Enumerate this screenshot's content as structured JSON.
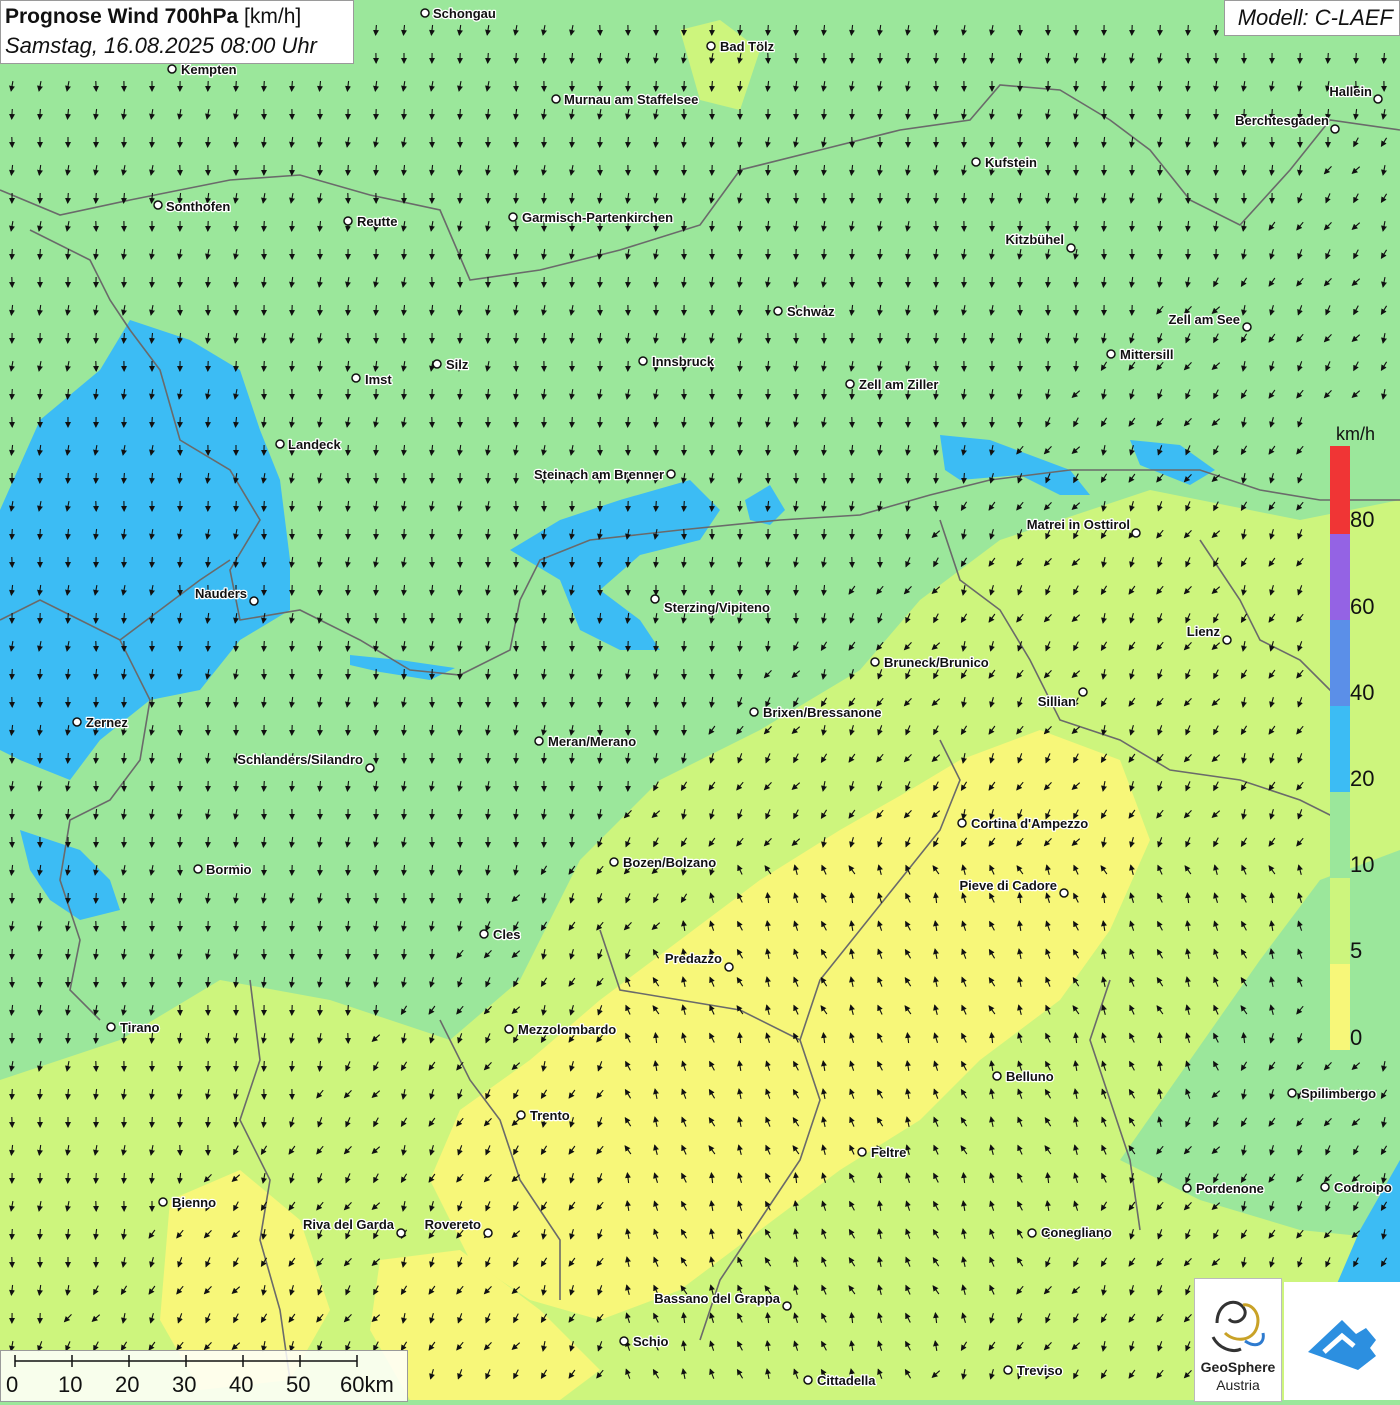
{
  "header": {
    "title_bold": "Prognose Wind 700hPa",
    "title_unit": "[km/h]",
    "datetime": "Samstag, 16.08.2025 08:00 Uhr"
  },
  "model_label": "Modell: C-LAEF",
  "legend": {
    "unit": "km/h",
    "labels": [
      "80",
      "60",
      "40",
      "20",
      "10",
      "5",
      "0"
    ],
    "colors": {
      "0-5": "#f7f779",
      "5-10": "#cdf57d",
      "10-20": "#9be79b",
      "20-40": "#3cbcf4",
      "40-60": "#5b8fe8",
      "60-80": "#9463e4",
      "80+": "#f03535"
    }
  },
  "scale_bar": {
    "labels": [
      "0",
      "10",
      "20",
      "30",
      "40",
      "50",
      "60km"
    ]
  },
  "logos": {
    "geosphere_line1": "GeoSphere",
    "geosphere_line2": "Austria"
  },
  "icons": [
    "wind-arrow-icon",
    "city-marker-icon",
    "geosphere-logo-icon",
    "cloud-arrow-logo-icon"
  ],
  "cities": [
    {
      "name": "Schongau"
    },
    {
      "name": "Bad Tölz"
    },
    {
      "name": "Kempten"
    },
    {
      "name": "Murnau am Staffelsee"
    },
    {
      "name": "Hallein"
    },
    {
      "name": "Berchtesgaden"
    },
    {
      "name": "Kufstein"
    },
    {
      "name": "Sonthofen"
    },
    {
      "name": "Reutte"
    },
    {
      "name": "Garmisch-Partenkirchen"
    },
    {
      "name": "Kitzbühel"
    },
    {
      "name": "Schwaz"
    },
    {
      "name": "Zell am See"
    },
    {
      "name": "Mittersill"
    },
    {
      "name": "Silz"
    },
    {
      "name": "Innsbruck"
    },
    {
      "name": "Imst"
    },
    {
      "name": "Zell am Ziller"
    },
    {
      "name": "Landeck"
    },
    {
      "name": "Steinach am Brenner"
    },
    {
      "name": "Matrei in Osttirol"
    },
    {
      "name": "Nauders"
    },
    {
      "name": "Sterzing/Vipiteno"
    },
    {
      "name": "Lienz"
    },
    {
      "name": "Bruneck/Brunico"
    },
    {
      "name": "Sillian"
    },
    {
      "name": "Zernez"
    },
    {
      "name": "Brixen/Bressanone"
    },
    {
      "name": "Meran/Merano"
    },
    {
      "name": "Schlanders/Silandro"
    },
    {
      "name": "Cortina d'Ampezzo"
    },
    {
      "name": "Bozen/Bolzano"
    },
    {
      "name": "Bormio"
    },
    {
      "name": "Pieve di Cadore"
    },
    {
      "name": "Cles"
    },
    {
      "name": "Predazzo"
    },
    {
      "name": "Tirano"
    },
    {
      "name": "Mezzolombardo"
    },
    {
      "name": "Belluno"
    },
    {
      "name": "Spilimbergo"
    },
    {
      "name": "Trento"
    },
    {
      "name": "Feltre"
    },
    {
      "name": "Pordenone"
    },
    {
      "name": "Codroipo"
    },
    {
      "name": "Bienno"
    },
    {
      "name": "Riva del Garda"
    },
    {
      "name": "Rovereto"
    },
    {
      "name": "Conegliano"
    },
    {
      "name": "Bassano del Grappa"
    },
    {
      "name": "Schio"
    },
    {
      "name": "Treviso"
    },
    {
      "name": "Cittadella"
    }
  ]
}
